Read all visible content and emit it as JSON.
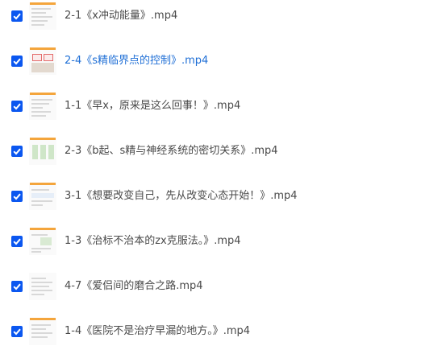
{
  "files": [
    {
      "name": "2-1《x冲动能量》.mp4",
      "checked": true,
      "highlighted": false
    },
    {
      "name": "2-4《s精临界点的控制》.mp4",
      "checked": true,
      "highlighted": true
    },
    {
      "name": "1-1《早x，原来是这么回事！》.mp4",
      "checked": true,
      "highlighted": false
    },
    {
      "name": "2-3《b起、s精与神经系统的密切关系》.mp4",
      "checked": true,
      "highlighted": false
    },
    {
      "name": "3-1《想要改变自己，先从改变心态开始！》.mp4",
      "checked": true,
      "highlighted": false
    },
    {
      "name": "1-3《治标不治本的zx克服法。》.mp4",
      "checked": true,
      "highlighted": false
    },
    {
      "name": "4-7《爱侣间的磨合之路.mp4",
      "checked": true,
      "highlighted": false
    },
    {
      "name": "1-4《医院不是治疗早漏的地方。》.mp4",
      "checked": true,
      "highlighted": false
    }
  ],
  "colors": {
    "checkbox": "#0b57f0",
    "highlight_text": "#1f6fd6",
    "text": "#4a4a4a"
  }
}
